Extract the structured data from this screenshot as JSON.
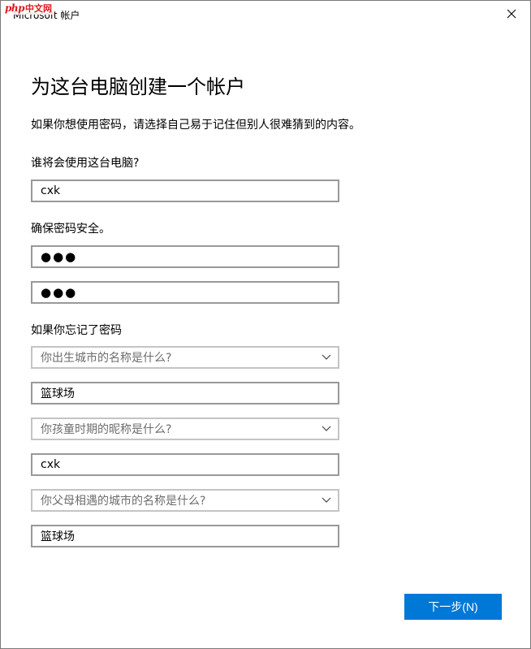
{
  "window": {
    "title": "Microsoft 帐户",
    "watermark_php": "php",
    "watermark_cn": "中文网"
  },
  "page": {
    "heading": "为这台电脑创建一个帐户",
    "description": "如果你想使用密码，请选择自己易于记住但别人很难猜到的内容。"
  },
  "user": {
    "label": "谁将会使用这台电脑?",
    "value": "cxk"
  },
  "password": {
    "label": "确保密码安全。",
    "value": "●●●",
    "confirm_value": "●●●"
  },
  "security": {
    "label": "如果你忘记了密码",
    "questions": [
      {
        "question": "你出生城市的名称是什么?",
        "answer": "篮球场"
      },
      {
        "question": "你孩童时期的昵称是什么?",
        "answer": "cxk"
      },
      {
        "question": "你父母相遇的城市的名称是什么?",
        "answer": "篮球场"
      }
    ]
  },
  "actions": {
    "next_label": "下一步(N)"
  },
  "colors": {
    "accent": "#0078d7",
    "border": "#999999",
    "placeholder": "#6d6d6d"
  }
}
